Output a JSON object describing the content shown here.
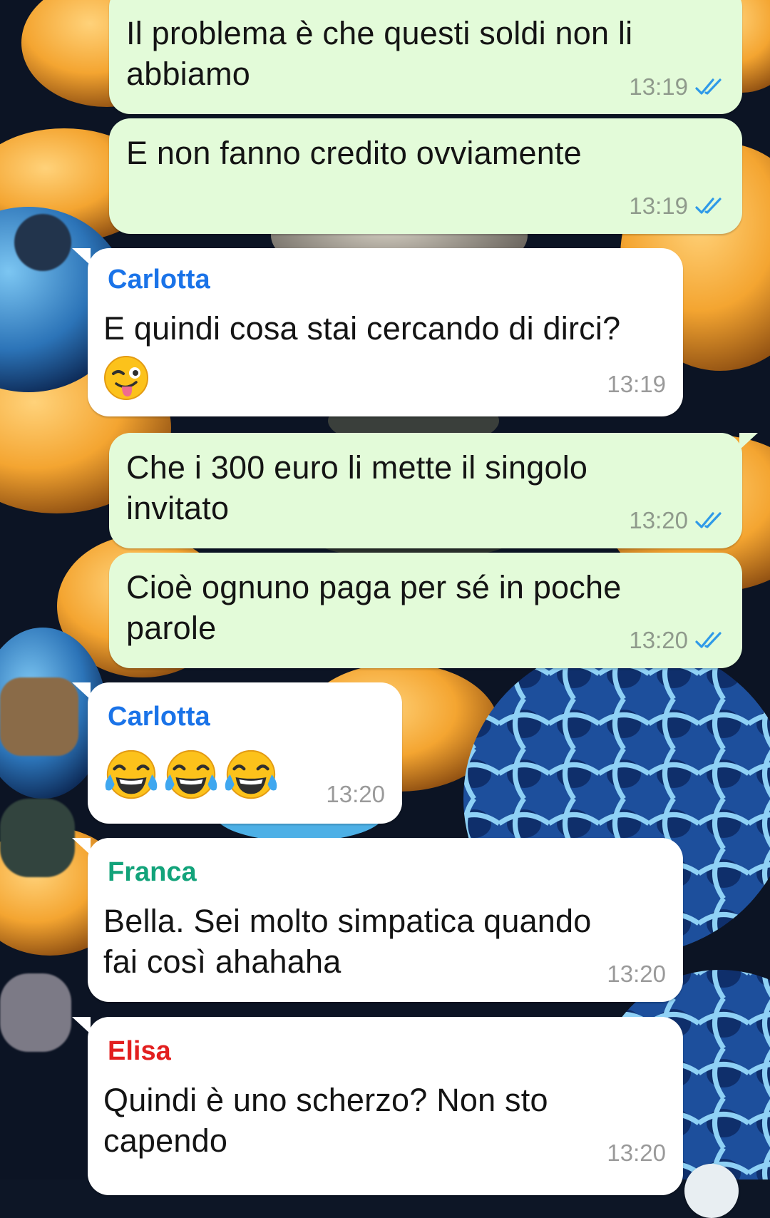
{
  "chat": {
    "messages": [
      {
        "direction": "out",
        "lines": [
          "Il problema è che questi soldi non li",
          "abbiamo"
        ],
        "time": "13:19",
        "read": true
      },
      {
        "direction": "out",
        "lines": [
          "E non fanno credito ovviamente"
        ],
        "time": "13:19",
        "read": true
      },
      {
        "direction": "in",
        "sender": "Carlotta",
        "sender_color": "#1a73e8",
        "lines": [
          "E quindi cosa stai cercando di dirci?"
        ],
        "emoji": [
          "winking-face-with-tongue"
        ],
        "time": "13:19"
      },
      {
        "direction": "out",
        "lines": [
          "Che i 300 euro li mette il singolo",
          "invitato"
        ],
        "time": "13:20",
        "read": true
      },
      {
        "direction": "out",
        "lines": [
          "Cioè ognuno paga per sé in poche",
          "parole"
        ],
        "time": "13:20",
        "read": true
      },
      {
        "direction": "in",
        "sender": "Carlotta",
        "sender_color": "#1a73e8",
        "lines": [],
        "emoji": [
          "face-with-tears-of-joy",
          "face-with-tears-of-joy",
          "face-with-tears-of-joy"
        ],
        "time": "13:20"
      },
      {
        "direction": "in",
        "sender": "Franca",
        "sender_color": "#12a37a",
        "lines": [
          "Bella. Sei molto simpatica quando",
          "fai così ahahaha"
        ],
        "time": "13:20"
      },
      {
        "direction": "in",
        "sender": "Elisa",
        "sender_color": "#e21f1f",
        "lines": [
          "Quindi è uno scherzo? Non sto",
          "capendo"
        ],
        "time": "13:20"
      }
    ]
  },
  "colors": {
    "outgoing_bubble": "#e3fbd9",
    "incoming_bubble": "#ffffff",
    "read_ticks": "#2f9ae8"
  }
}
